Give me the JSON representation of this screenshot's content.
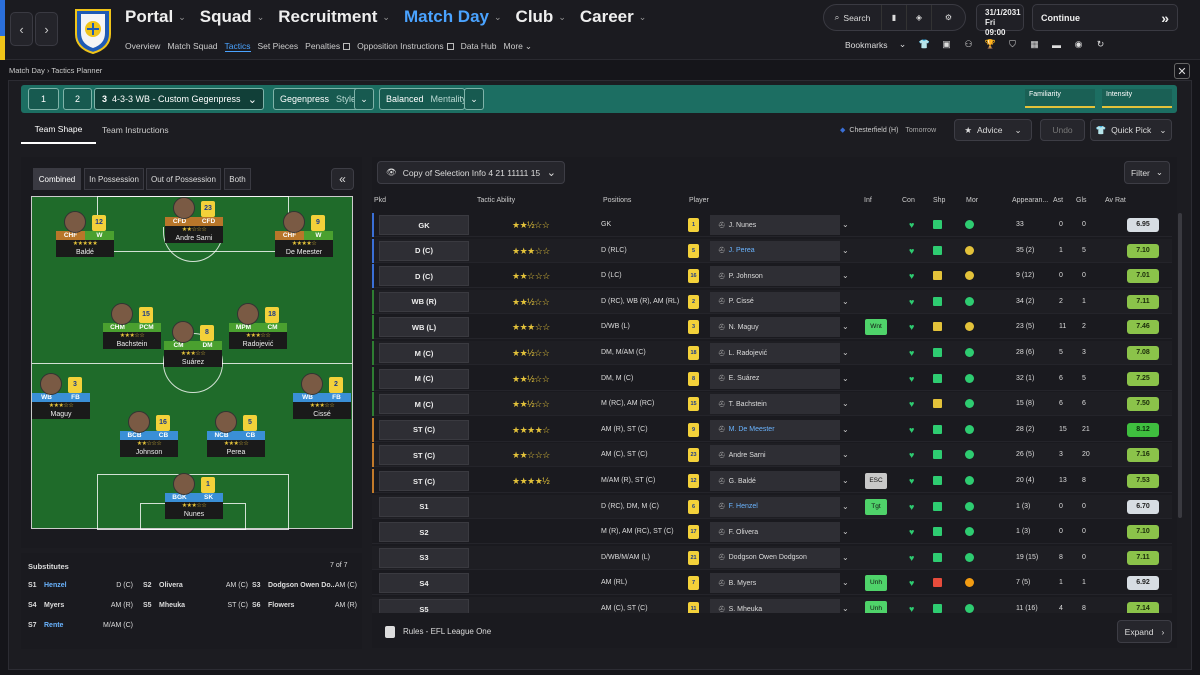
{
  "nav": {
    "main": [
      {
        "label": "Portal",
        "active": false
      },
      {
        "label": "Squad",
        "active": false
      },
      {
        "label": "Recruitment",
        "active": false
      },
      {
        "label": "Match Day",
        "active": true
      },
      {
        "label": "Club",
        "active": false
      },
      {
        "label": "Career",
        "active": false
      }
    ],
    "sub": [
      {
        "label": "Overview",
        "active": false,
        "ext": false
      },
      {
        "label": "Match Squad",
        "active": false,
        "ext": false
      },
      {
        "label": "Tactics",
        "active": true,
        "ext": false
      },
      {
        "label": "Set Pieces",
        "active": false,
        "ext": false
      },
      {
        "label": "Penalties",
        "active": false,
        "ext": true
      },
      {
        "label": "Opposition Instructions",
        "active": false,
        "ext": true
      },
      {
        "label": "Data Hub",
        "active": false,
        "ext": false
      },
      {
        "label": "More",
        "active": false,
        "ext": false
      }
    ],
    "search_label": "Search",
    "date_line1": "31/1/2031",
    "date_line2": "Fri  09:00",
    "continue_label": "Continue",
    "bookmarks_label": "Bookmarks"
  },
  "breadcrumb": {
    "root": "Match Day",
    "current": "Tactics Planner"
  },
  "tactic": {
    "slot1": "1",
    "slot2": "2",
    "slot3_num": "3",
    "name": "4-3-3 WB - Custom Gegenpress",
    "style_value": "Gegenpress",
    "style_label": "Style",
    "mentality_value": "Balanced",
    "mentality_label": "Mentality",
    "familiarity_label": "Familiarity",
    "intensity_label": "Intensity"
  },
  "tabs": {
    "team_shape": "Team Shape",
    "team_instructions": "Team Instructions"
  },
  "fixture": {
    "opponent": "Chesterfield (H)",
    "when": "Tomorrow"
  },
  "buttons": {
    "advice": "Advice",
    "undo": "Undo",
    "quick_pick": "Quick Pick",
    "filter": "Filter",
    "expand": "Expand"
  },
  "view_tabs": [
    "Combined",
    "In Possession",
    "Out of Possession",
    "Both"
  ],
  "selection": "Copy of Selection Info 4 21 11111 15",
  "pitch_players": [
    {
      "name": "Andre Sarni",
      "r1": "CFD",
      "r2": "CFD",
      "c1": "#b8762a",
      "c2": "#b8762a",
      "kit": "23",
      "stars": "★★☆☆☆"
    },
    {
      "name": "Baldé",
      "r1": "CHF",
      "r2": "W",
      "c1": "#b8762a",
      "c2": "#4aa02f",
      "kit": "12",
      "stars": "★★★★★"
    },
    {
      "name": "De Meester",
      "r1": "CHF",
      "r2": "W",
      "c1": "#b8762a",
      "c2": "#4aa02f",
      "kit": "9",
      "stars": "★★★★☆"
    },
    {
      "name": "Bachstein",
      "r1": "CHM",
      "r2": "PCM",
      "c1": "#4aa02f",
      "c2": "#4aa02f",
      "kit": "15",
      "stars": "★★★☆☆"
    },
    {
      "name": "Radojević",
      "r1": "MPM",
      "r2": "CM",
      "c1": "#4aa02f",
      "c2": "#4aa02f",
      "kit": "18",
      "stars": "★★★☆☆"
    },
    {
      "name": "Suárez",
      "r1": "CM",
      "r2": "DM",
      "c1": "#4aa02f",
      "c2": "#4aa02f",
      "kit": "8",
      "stars": "★★★☆☆"
    },
    {
      "name": "Maguy",
      "r1": "WB",
      "r2": "FB",
      "c1": "#3a8fd6",
      "c2": "#3a8fd6",
      "kit": "3",
      "stars": "★★★☆☆"
    },
    {
      "name": "Cissé",
      "r1": "WB",
      "r2": "FB",
      "c1": "#3a8fd6",
      "c2": "#3a8fd6",
      "kit": "2",
      "stars": "★★★☆☆"
    },
    {
      "name": "Johnson",
      "r1": "BCB",
      "r2": "CB",
      "c1": "#3a8fd6",
      "c2": "#3a8fd6",
      "kit": "16",
      "stars": "★★☆☆☆"
    },
    {
      "name": "Perea",
      "r1": "NCB",
      "r2": "CB",
      "c1": "#3a8fd6",
      "c2": "#3a8fd6",
      "kit": "5",
      "stars": "★★★☆☆"
    },
    {
      "name": "Nunes",
      "r1": "BGK",
      "r2": "SK",
      "c1": "#3a8fd6",
      "c2": "#3a8fd6",
      "kit": "1",
      "stars": "★★★☆☆"
    }
  ],
  "substitutes": {
    "title": "Substitutes",
    "count": "7 of 7",
    "list": [
      {
        "slot": "S1",
        "name": "Henzel",
        "pos": "D (C)",
        "blue": true
      },
      {
        "slot": "S2",
        "name": "Olivera",
        "pos": "AM (C)",
        "blue": false
      },
      {
        "slot": "S3",
        "name": "Dodgson Owen Do...",
        "pos": "AM (C)",
        "blue": false
      },
      {
        "slot": "S4",
        "name": "Myers",
        "pos": "AM (R)",
        "blue": false
      },
      {
        "slot": "S5",
        "name": "Mheuka",
        "pos": "ST (C)",
        "blue": false
      },
      {
        "slot": "S6",
        "name": "Flowers",
        "pos": "AM (R)",
        "blue": false
      },
      {
        "slot": "S7",
        "name": "Rente",
        "pos": "M/AM (C)",
        "blue": true
      }
    ]
  },
  "table": {
    "headers": {
      "pkd": "Pkd",
      "tactic_ability": "Tactic Ability",
      "positions": "Positions",
      "player": "Player",
      "inf": "Inf",
      "con": "Con",
      "shp": "Shp",
      "mor": "Mor",
      "apps": "Appearan...",
      "ast": "Ast",
      "gls": "Gls",
      "avrat": "Av Rat"
    },
    "rows": [
      {
        "pos": "GK",
        "stars": "★★½☆☆",
        "positions": "GK",
        "kit": "1",
        "player": "J. Nunes",
        "blue": false,
        "inf": "",
        "shp": "ok",
        "mor": "ok",
        "apps": "33",
        "ast": "0",
        "gls": "0",
        "rat": "6.95",
        "bar": "#3a6fd6"
      },
      {
        "pos": "D (C)",
        "stars": "★★★☆☆",
        "positions": "D (RLC)",
        "kit": "5",
        "player": "J. Perea",
        "blue": true,
        "inf": "",
        "shp": "ok",
        "mor": "warn",
        "apps": "35 (2)",
        "ast": "1",
        "gls": "5",
        "rat": "7.10",
        "bar": "#3a6fd6"
      },
      {
        "pos": "D (C)",
        "stars": "★★☆☆☆",
        "positions": "D (LC)",
        "kit": "16",
        "player": "P. Johnson",
        "blue": false,
        "inf": "",
        "shp": "mid",
        "mor": "warn",
        "apps": "9 (12)",
        "ast": "0",
        "gls": "0",
        "rat": "7.01",
        "bar": "#3a6fd6"
      },
      {
        "pos": "WB (R)",
        "stars": "★★½☆☆",
        "positions": "D (RC), WB (R), AM (RL)",
        "kit": "2",
        "player": "P. Cissé",
        "blue": false,
        "inf": "",
        "shp": "ok",
        "mor": "ok",
        "apps": "34 (2)",
        "ast": "2",
        "gls": "1",
        "rat": "7.11",
        "bar": "#2e7d32"
      },
      {
        "pos": "WB (L)",
        "stars": "★★★☆☆",
        "positions": "D/WB (L)",
        "kit": "3",
        "player": "N. Maguy",
        "blue": false,
        "inf": "Wnt",
        "shp": "mid",
        "mor": "warn",
        "apps": "23 (5)",
        "ast": "11",
        "gls": "2",
        "rat": "7.46",
        "bar": "#2e7d32"
      },
      {
        "pos": "M (C)",
        "stars": "★★½☆☆",
        "positions": "DM, M/AM (C)",
        "kit": "18",
        "player": "L. Radojević",
        "blue": false,
        "inf": "",
        "shp": "ok",
        "mor": "ok",
        "apps": "28 (6)",
        "ast": "5",
        "gls": "3",
        "rat": "7.08",
        "bar": "#2e7d32"
      },
      {
        "pos": "M (C)",
        "stars": "★★½☆☆",
        "positions": "DM, M (C)",
        "kit": "8",
        "player": "E. Suárez",
        "blue": false,
        "inf": "",
        "shp": "ok",
        "mor": "ok",
        "apps": "32 (1)",
        "ast": "6",
        "gls": "5",
        "rat": "7.25",
        "bar": "#2e7d32"
      },
      {
        "pos": "M (C)",
        "stars": "★★½☆☆",
        "positions": "M (RC), AM (RC)",
        "kit": "15",
        "player": "T. Bachstein",
        "blue": false,
        "inf": "",
        "shp": "mid",
        "mor": "ok",
        "apps": "15 (8)",
        "ast": "6",
        "gls": "6",
        "rat": "7.50",
        "bar": "#2e7d32"
      },
      {
        "pos": "ST (C)",
        "stars": "★★★★☆",
        "positions": "AM (R), ST (C)",
        "kit": "9",
        "player": "M. De Meester",
        "blue": true,
        "inf": "",
        "shp": "ok",
        "mor": "ok",
        "apps": "28 (2)",
        "ast": "15",
        "gls": "21",
        "rat": "8.12",
        "bar": "#c27a2a"
      },
      {
        "pos": "ST (C)",
        "stars": "★★☆☆☆",
        "positions": "AM (C), ST (C)",
        "kit": "23",
        "player": "Andre Sarni",
        "blue": false,
        "inf": "",
        "shp": "ok",
        "mor": "ok",
        "apps": "26 (5)",
        "ast": "3",
        "gls": "20",
        "rat": "7.16",
        "bar": "#c27a2a"
      },
      {
        "pos": "ST (C)",
        "stars": "★★★★½",
        "positions": "M/AM (R), ST (C)",
        "kit": "12",
        "player": "G. Baldé",
        "blue": false,
        "inf": "ESC",
        "shp": "ok",
        "mor": "ok",
        "apps": "20 (4)",
        "ast": "13",
        "gls": "8",
        "rat": "7.53",
        "bar": "#c27a2a"
      },
      {
        "pos": "S1",
        "stars": "",
        "positions": "D (RC), DM, M (C)",
        "kit": "6",
        "player": "F. Henzel",
        "blue": true,
        "inf": "Tgt",
        "shp": "ok",
        "mor": "ok",
        "apps": "1 (3)",
        "ast": "0",
        "gls": "0",
        "rat": "6.70",
        "bar": ""
      },
      {
        "pos": "S2",
        "stars": "",
        "positions": "M (R), AM (RC), ST (C)",
        "kit": "17",
        "player": "F. Olivera",
        "blue": false,
        "inf": "",
        "shp": "ok",
        "mor": "ok",
        "apps": "1 (3)",
        "ast": "0",
        "gls": "0",
        "rat": "7.10",
        "bar": ""
      },
      {
        "pos": "S3",
        "stars": "",
        "positions": "D/WB/M/AM (L)",
        "kit": "21",
        "player": "Dodgson Owen Dodgson",
        "blue": false,
        "inf": "",
        "shp": "ok",
        "mor": "ok",
        "apps": "19 (15)",
        "ast": "8",
        "gls": "0",
        "rat": "7.11",
        "bar": ""
      },
      {
        "pos": "S4",
        "stars": "",
        "positions": "AM (RL)",
        "kit": "7",
        "player": "B. Myers",
        "blue": false,
        "inf": "Unh",
        "shp": "bad",
        "mor": "bad",
        "apps": "7 (5)",
        "ast": "1",
        "gls": "1",
        "rat": "6.92",
        "bar": ""
      },
      {
        "pos": "S5",
        "stars": "",
        "positions": "AM (C), ST (C)",
        "kit": "11",
        "player": "S. Mheuka",
        "blue": false,
        "inf": "Unh",
        "shp": "ok",
        "mor": "ok",
        "apps": "11 (16)",
        "ast": "4",
        "gls": "8",
        "rat": "7.14",
        "bar": ""
      }
    ]
  },
  "rules_label": "Rules - EFL League One",
  "colors": {
    "accent": "#4aa3ff",
    "teal": "#1c6e62",
    "star": "#e3c23a",
    "good": "#2ecc71"
  }
}
